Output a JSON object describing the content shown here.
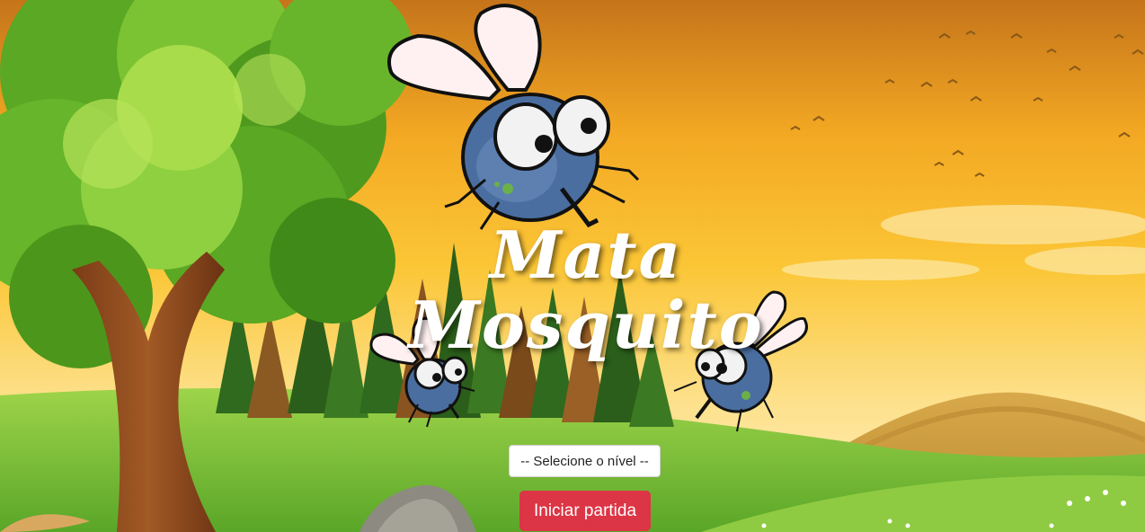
{
  "game": {
    "title_line1": "Mata",
    "title_line2": "Mosquito"
  },
  "controls": {
    "level_select": {
      "selected": "-- Selecione o nível --",
      "options": [
        "-- Selecione o nível --"
      ]
    },
    "start_label": "Iniciar partida"
  },
  "colors": {
    "sky_top": "#c8781a",
    "sky_mid": "#f5b52a",
    "sky_low": "#fde38a",
    "grass": "#7cc134",
    "tree_green": "#6cbf2a",
    "mosquito_body": "#4a6ea0",
    "start_button": "#dc3545"
  }
}
